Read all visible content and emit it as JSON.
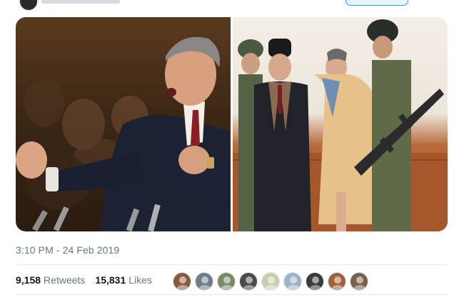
{
  "tweet": {
    "timestamp": "3:10 PM - 24 Feb 2019",
    "media": [
      {
        "alt_name": "left-photo"
      },
      {
        "alt_name": "right-photo"
      }
    ]
  },
  "stats": {
    "retweets_count": "9,158",
    "retweets_label": "Retweets",
    "likes_count": "15,831",
    "likes_label": "Likes"
  },
  "likers": [
    {
      "name": "liker-1",
      "bg": "#8a5a3c"
    },
    {
      "name": "liker-2",
      "bg": "#6e7c8c"
    },
    {
      "name": "liker-3",
      "bg": "#7b8a66"
    },
    {
      "name": "liker-4",
      "bg": "#4a4a4a"
    },
    {
      "name": "liker-5",
      "bg": "#c9cfa8"
    },
    {
      "name": "liker-6",
      "bg": "#9fb2c7"
    },
    {
      "name": "liker-7",
      "bg": "#3a3a3a"
    },
    {
      "name": "liker-8",
      "bg": "#a0623c"
    },
    {
      "name": "liker-9",
      "bg": "#7a6048"
    }
  ],
  "colors": {
    "secondary_text": "#657786",
    "primary_text": "#14171a",
    "divider": "#e6ecf0",
    "accent": "#1da1f2"
  }
}
